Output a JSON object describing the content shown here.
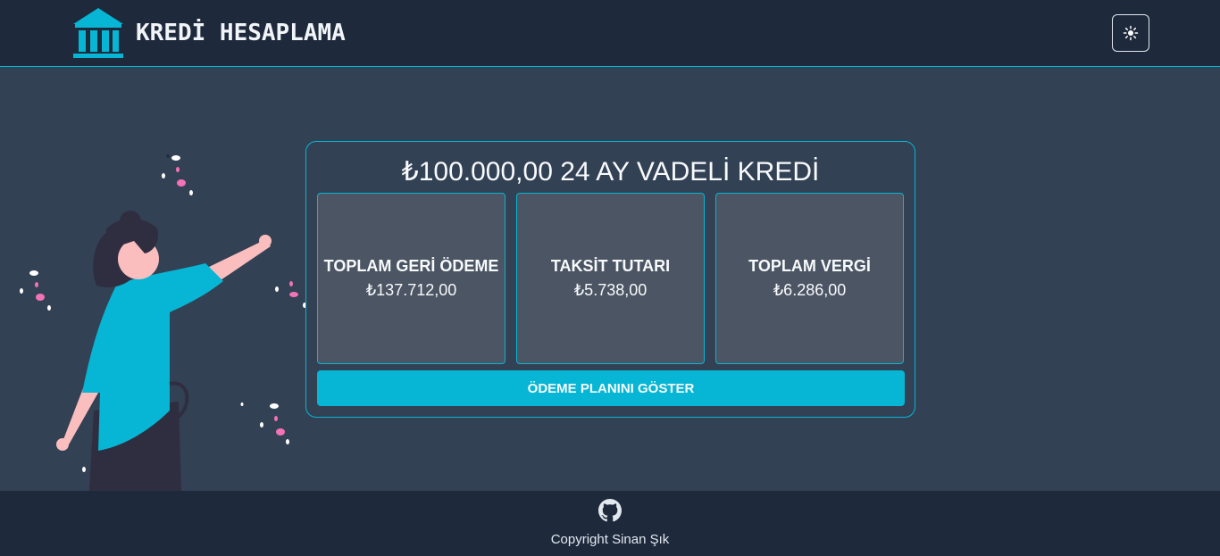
{
  "header": {
    "title": "KREDİ HESAPLAMA",
    "logo_icon": "bank-icon",
    "theme_toggle_icon": "sun-icon"
  },
  "loan": {
    "title": "₺100.000,00 24 AY VADELİ KREDİ",
    "stats": [
      {
        "label": "TOPLAM GERİ ÖDEME",
        "value": "₺137.712,00"
      },
      {
        "label": "TAKSİT TUTARI",
        "value": "₺5.738,00"
      },
      {
        "label": "TOPLAM VERGİ",
        "value": "₺6.286,00"
      }
    ],
    "button_label": "ÖDEME PLANINI GÖSTER"
  },
  "footer": {
    "github_icon": "github-icon",
    "copyright": "Copyright Sinan Şık"
  },
  "colors": {
    "accent": "#06b6d4",
    "header_bg": "#1e293b",
    "page_bg": "#334155",
    "stat_bg": "#4b5563",
    "confetti": "#f472b6"
  }
}
